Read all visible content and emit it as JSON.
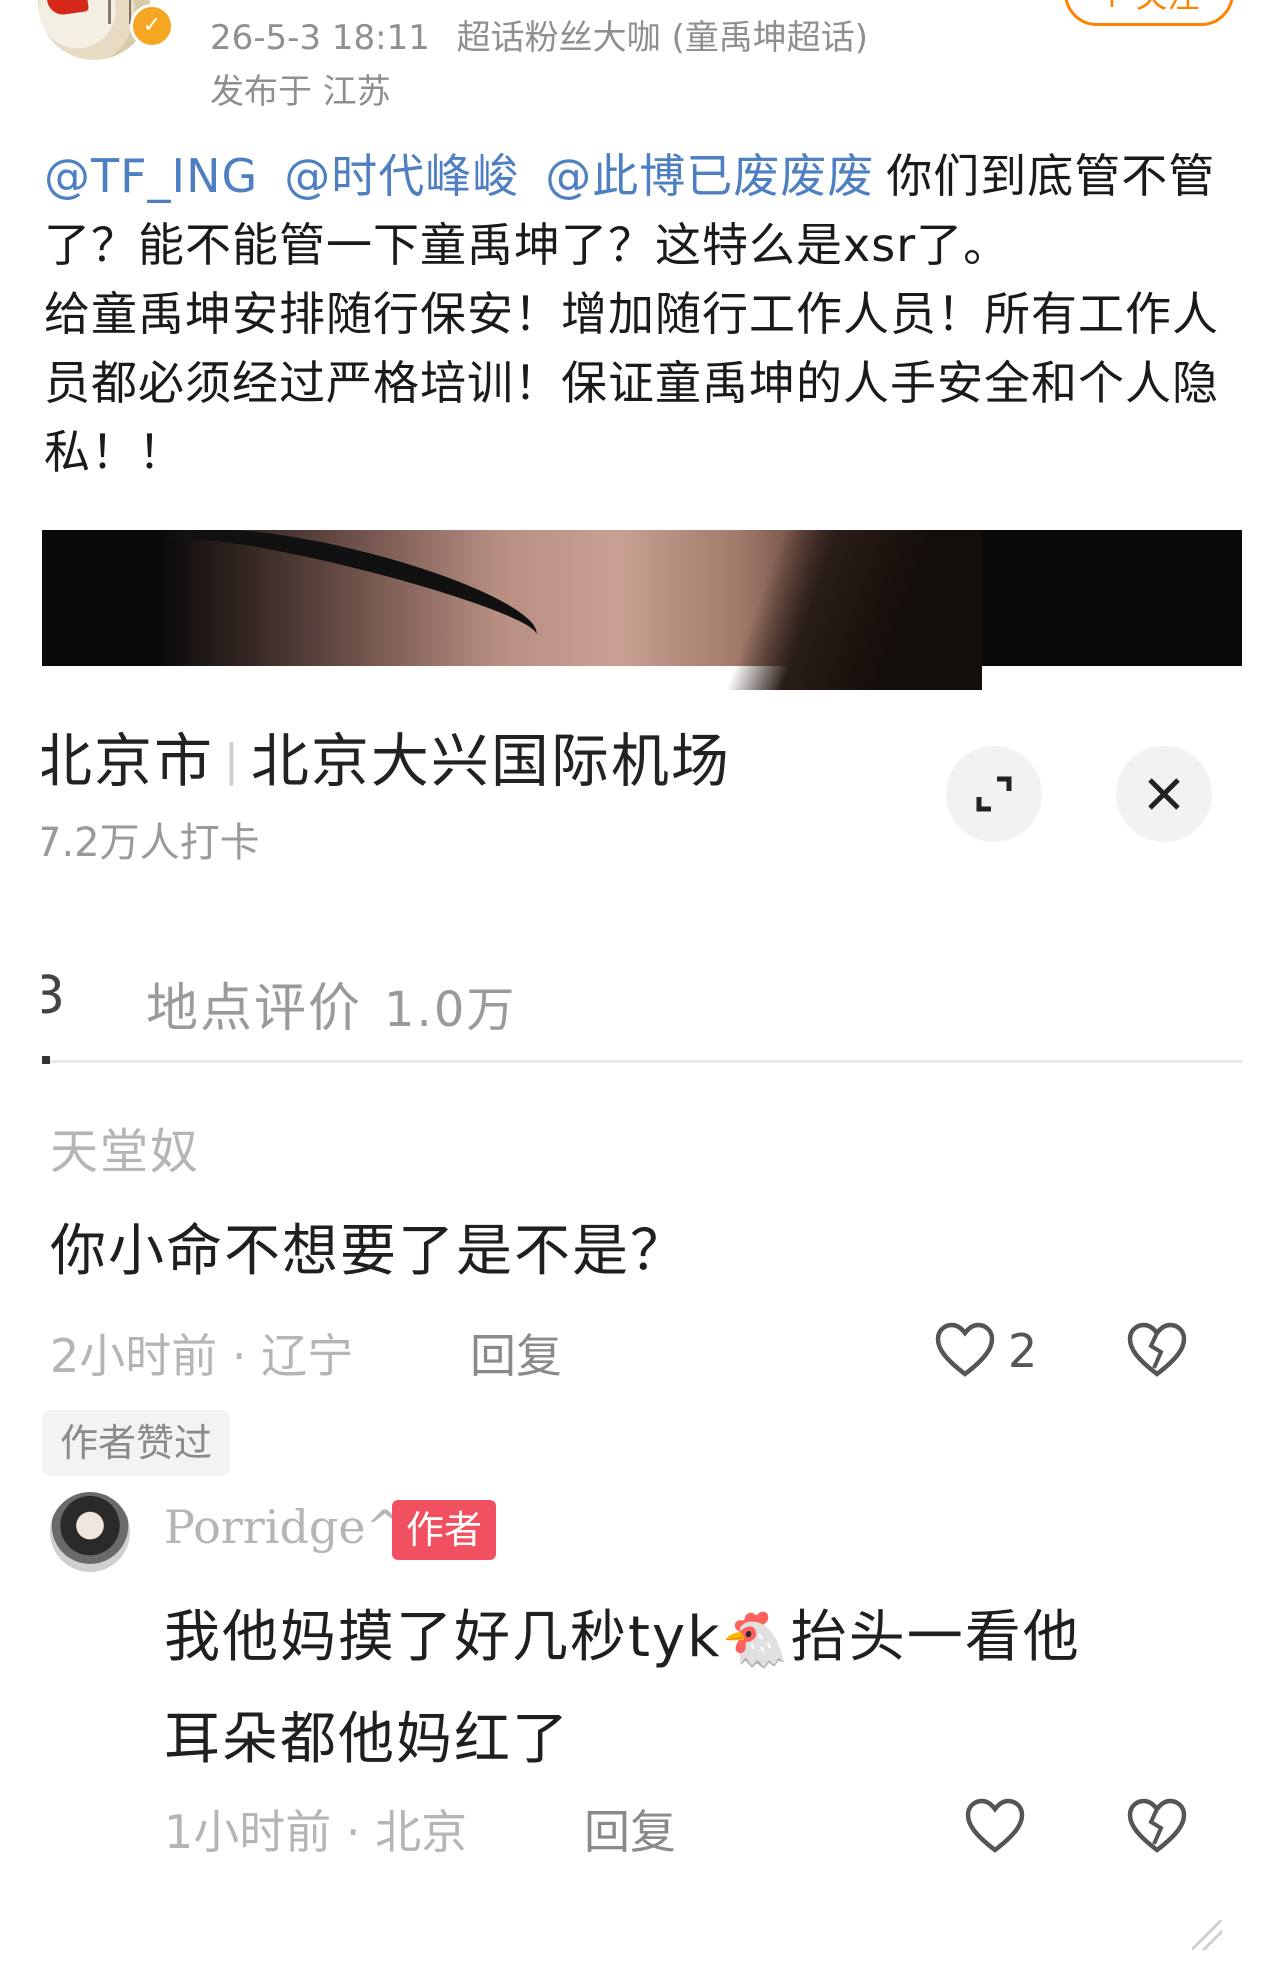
{
  "post": {
    "time": "26-5-3 18:11",
    "source": "超话粉丝大咖 (童禹坤超话)",
    "location": "发布于 江苏",
    "follow_label": "+ 关注",
    "verified_icon": "verified-badge-icon",
    "mentions": [
      "@TF_ING",
      "@时代峰峻",
      "@此博已废废废"
    ],
    "text_line1_tail": "你们到底管不管",
    "text_line2": "了？能不能管一下童禹坤了？这特么是xsr了。",
    "text_line3": "给童禹坤安排随行保安！增加随行工作人员！所有工作人",
    "text_line4": "员都必须经过严格培训！保证童禹坤的人手安全和个人隐",
    "text_line5": "私！！",
    "mention_color": "#4d7fc1"
  },
  "screenshot": {
    "place": {
      "city": "北京市",
      "name": "北京大兴国际机场",
      "checkins": "7.2万人打卡",
      "expand_icon": "expand-icon",
      "close_icon": "close-icon"
    },
    "tabs": {
      "partial": "3",
      "reviews_label": "地点评价",
      "reviews_count": "1.0万"
    },
    "comments": [
      {
        "user": "天堂奴",
        "text": "你小命不想要了是不是？",
        "time_loc": "2小时前 · 辽宁",
        "reply": "回复",
        "likes": "2",
        "badge": "作者赞过"
      },
      {
        "user": "Porridge^",
        "tag": "作者",
        "text_before": "我他妈摸了好几秒tyk",
        "emoji": "🐔",
        "text_after": "抬头一看他",
        "text_line2": "耳朵都他妈红了",
        "time_loc": "1小时前 · 北京",
        "reply": "回复",
        "likes": ""
      }
    ],
    "author_tag_color": "#f0505f"
  }
}
